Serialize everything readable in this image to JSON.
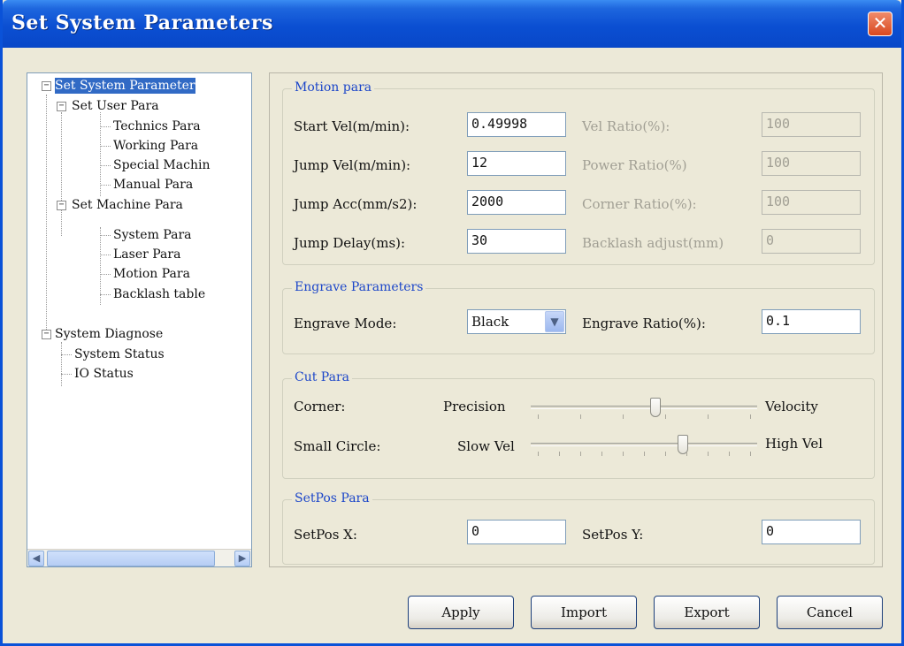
{
  "window": {
    "title": "Set System Parameters",
    "close_glyph": "✕"
  },
  "tree": {
    "nodes": [
      {
        "label": "Set System Parameter",
        "toggle": "−",
        "selected": true
      },
      {
        "label": "Set User Para",
        "toggle": "−"
      },
      {
        "label": "Technics Para"
      },
      {
        "label": "Working Para"
      },
      {
        "label": "Special Machin"
      },
      {
        "label": "Manual Para"
      },
      {
        "label": "Set Machine Para",
        "toggle": "−"
      },
      {
        "label": "System Para"
      },
      {
        "label": "Laser Para"
      },
      {
        "label": "Motion Para"
      },
      {
        "label": "Backlash table"
      },
      {
        "label": "System Diagnose",
        "toggle": "−"
      },
      {
        "label": "System Status"
      },
      {
        "label": "IO Status"
      }
    ],
    "scroll_left": "◀",
    "scroll_right": "▶"
  },
  "motion": {
    "legend": "Motion para",
    "start_vel_label": "Start Vel(m/min):",
    "start_vel_value": "0.49998",
    "jump_vel_label": "Jump Vel(m/min):",
    "jump_vel_value": "12",
    "jump_acc_label": "Jump Acc(mm/s2):",
    "jump_acc_value": "2000",
    "jump_delay_label": "Jump Delay(ms):",
    "jump_delay_value": "30",
    "vel_ratio_label": "Vel Ratio(%):",
    "vel_ratio_value": "100",
    "power_ratio_label": "Power Ratio(%)",
    "power_ratio_value": "100",
    "corner_ratio_label": "Corner Ratio(%):",
    "corner_ratio_value": "100",
    "backlash_label": "Backlash adjust(mm)",
    "backlash_value": "0"
  },
  "engrave": {
    "legend": "Engrave Parameters",
    "mode_label": "Engrave Mode:",
    "mode_value": "Black",
    "ratio_label": "Engrave Ratio(%):",
    "ratio_value": "0.1"
  },
  "cut": {
    "legend": "Cut Para",
    "corner_label": "Corner:",
    "corner_min": "Precision",
    "corner_max": "Velocity",
    "corner_level": 0.55,
    "circle_label": "Small Circle:",
    "circle_min": "Slow Vel",
    "circle_max": "High Vel",
    "circle_level": 0.67
  },
  "setpos": {
    "legend": "SetPos Para",
    "x_label": "SetPos X:",
    "x_value": "0",
    "y_label": "SetPos Y:",
    "y_value": "0"
  },
  "buttons": {
    "apply": "Apply",
    "import": "Import",
    "export": "Export",
    "cancel": "Cancel"
  }
}
